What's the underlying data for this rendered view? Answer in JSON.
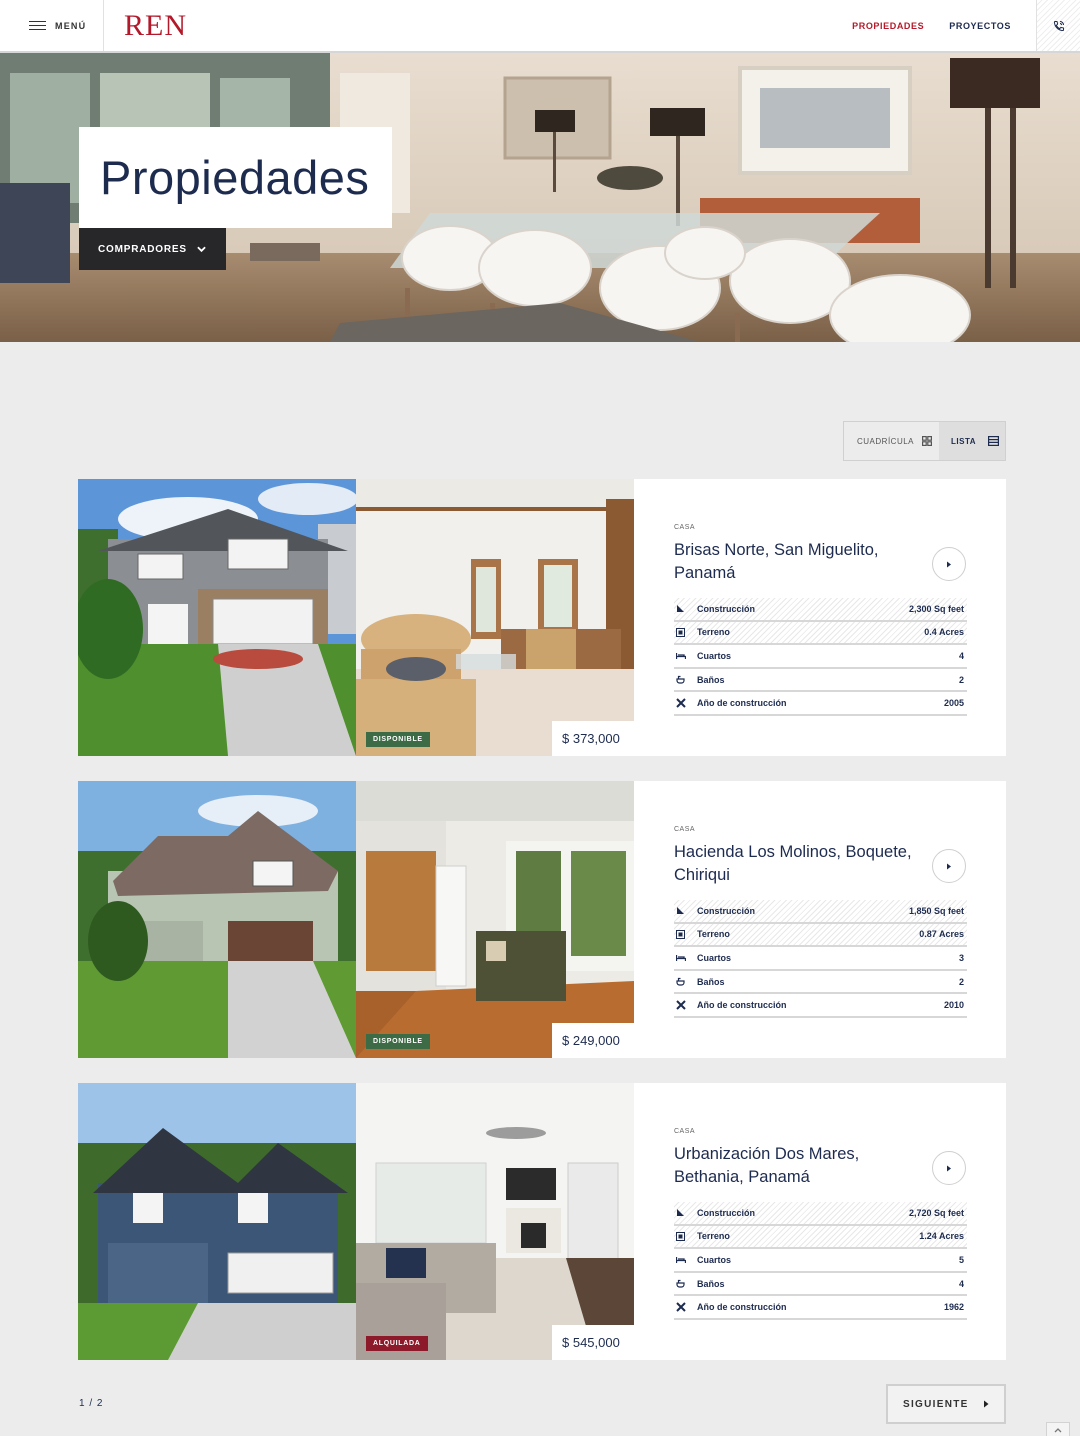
{
  "header": {
    "menu_label": "MENÚ",
    "logo": "REN",
    "nav": [
      {
        "label": "PROPIEDADES",
        "active": true
      },
      {
        "label": "PROYECTOS",
        "active": false
      }
    ]
  },
  "hero": {
    "title": "Propiedades",
    "dropdown_label": "COMPRADORES"
  },
  "view_toggle": {
    "grid_label": "CUADRÍCULA",
    "list_label": "LISTA",
    "selected": "LISTA"
  },
  "listings": [
    {
      "type": "CASA",
      "name": "Brisas Norte, San Miguelito, Panamá",
      "status": "DISPONIBLE",
      "price": "$ 373,000",
      "specs": [
        {
          "icon": "construction-area-icon",
          "label": "Construcción",
          "value": "2,300 Sq feet"
        },
        {
          "icon": "land-icon",
          "label": "Terreno",
          "value": "0.4 Acres"
        },
        {
          "icon": "bed-icon",
          "label": "Cuartos",
          "value": "4"
        },
        {
          "icon": "bath-icon",
          "label": "Baños",
          "value": "2"
        },
        {
          "icon": "tools-icon",
          "label": "Año de construcción",
          "value": "2005"
        }
      ]
    },
    {
      "type": "CASA",
      "name": "Hacienda Los Molinos, Boquete, Chiriqui",
      "status": "DISPONIBLE",
      "price": "$ 249,000",
      "specs": [
        {
          "icon": "construction-area-icon",
          "label": "Construcción",
          "value": "1,850 Sq feet"
        },
        {
          "icon": "land-icon",
          "label": "Terreno",
          "value": "0.87 Acres"
        },
        {
          "icon": "bed-icon",
          "label": "Cuartos",
          "value": "3"
        },
        {
          "icon": "bath-icon",
          "label": "Baños",
          "value": "2"
        },
        {
          "icon": "tools-icon",
          "label": "Año de construcción",
          "value": "2010"
        }
      ]
    },
    {
      "type": "CASA",
      "name": "Urbanización Dos Mares, Bethania, Panamá",
      "status": "ALQUILADA",
      "price": "$ 545,000",
      "specs": [
        {
          "icon": "construction-area-icon",
          "label": "Construcción",
          "value": "2,720 Sq feet"
        },
        {
          "icon": "land-icon",
          "label": "Terreno",
          "value": "1.24 Acres"
        },
        {
          "icon": "bed-icon",
          "label": "Cuartos",
          "value": "5"
        },
        {
          "icon": "bath-icon",
          "label": "Baños",
          "value": "4"
        },
        {
          "icon": "tools-icon",
          "label": "Año de construcción",
          "value": "1962"
        }
      ]
    }
  ],
  "pagination": {
    "current": "1 / 2",
    "next_label": "SIGUIENTE"
  },
  "colors": {
    "brand_red": "#b3192a",
    "navy": "#1d2b4f",
    "available_green": "#3c6b45",
    "rented_red": "#8d1a2a",
    "page_bg": "#ececec"
  }
}
